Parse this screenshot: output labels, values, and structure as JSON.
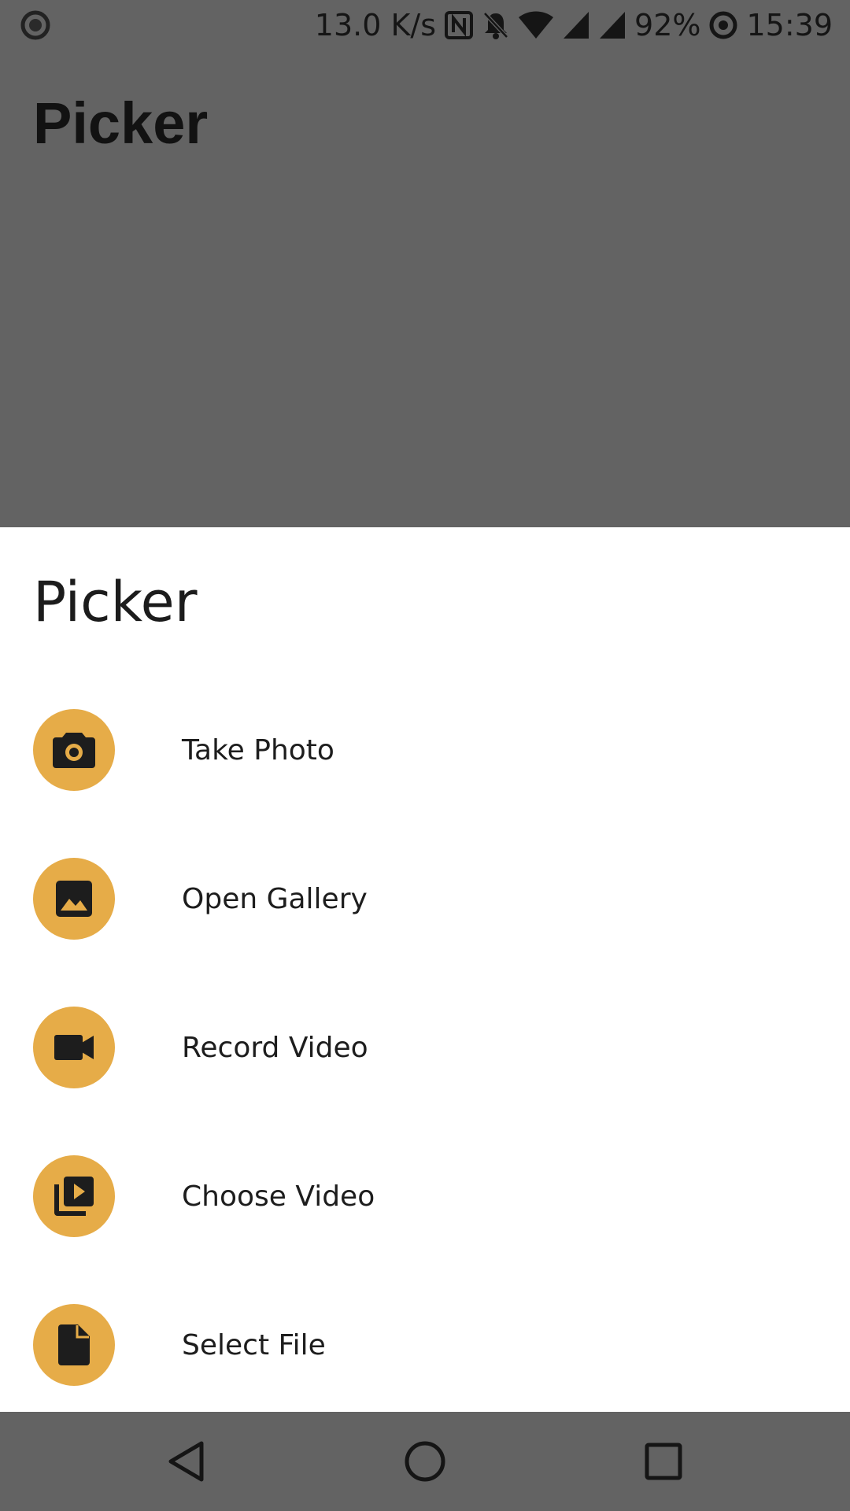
{
  "status_bar": {
    "left_icon": "status-dot-icon",
    "network_speed": "13.0 K/s",
    "icons": [
      "nfc-icon",
      "bell-off-icon",
      "wifi-icon",
      "signal-icon",
      "signal-icon"
    ],
    "battery": "92%",
    "battery_icon": "battery-ring-icon",
    "time": "15:39"
  },
  "page": {
    "title": "Picker"
  },
  "sheet": {
    "title": "Picker",
    "accent_color": "#e6ac48",
    "options": [
      {
        "label": "Take Photo",
        "icon": "camera-icon"
      },
      {
        "label": "Open Gallery",
        "icon": "image-icon"
      },
      {
        "label": "Record Video",
        "icon": "videocam-icon"
      },
      {
        "label": "Choose Video",
        "icon": "video-library-icon"
      },
      {
        "label": "Select File",
        "icon": "file-icon"
      }
    ]
  },
  "nav_bar": {
    "buttons": [
      "back-icon",
      "home-icon",
      "recents-icon"
    ]
  }
}
